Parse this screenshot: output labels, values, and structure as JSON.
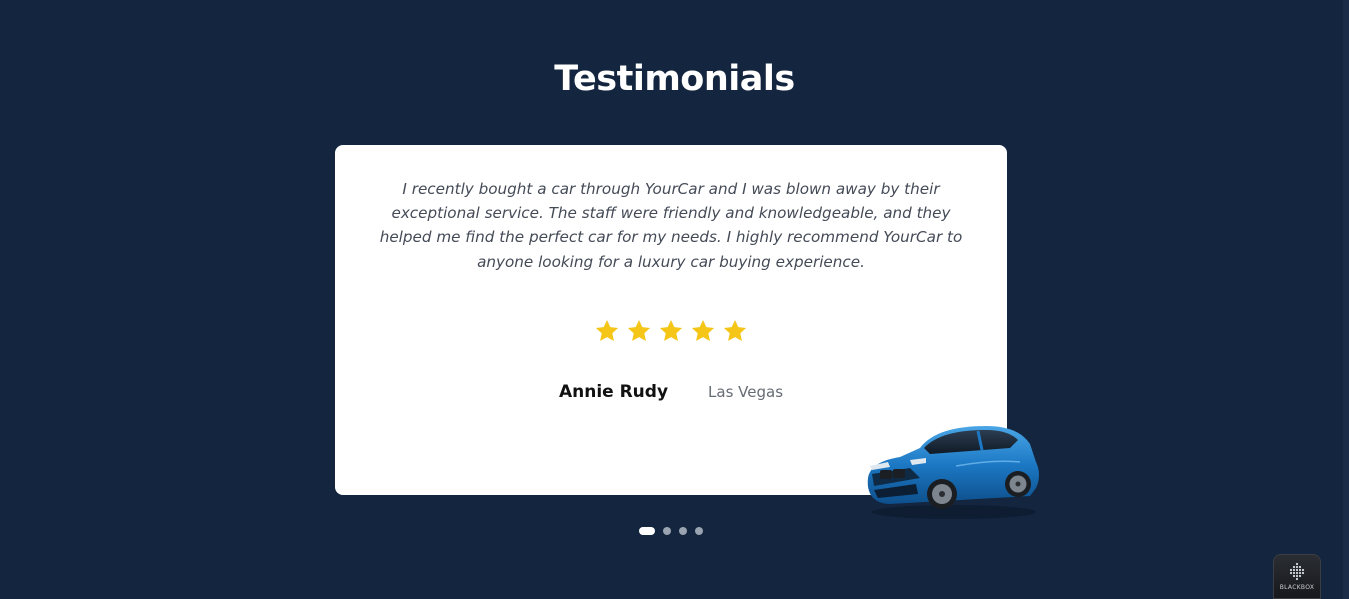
{
  "section": {
    "title": "Testimonials"
  },
  "testimonial": {
    "quote": "I recently bought a car through YourCar and I was blown away by their exceptional service. The staff were friendly and knowledgeable, and they helped me find the perfect car for my needs. I highly recommend YourCar to anyone looking for a luxury car buying experience.",
    "rating": 5,
    "rating_max": 5,
    "author": "Annie Rudy",
    "location": "Las Vegas",
    "image_icon": "car-image"
  },
  "carousel": {
    "slide_count": 4,
    "active_index": 0
  },
  "badge": {
    "label": "BLACKBOX",
    "icon": "blackbox-logo-icon"
  },
  "colors": {
    "background": "#13253f",
    "card": "#ffffff",
    "star": "#f5c518",
    "dot_active": "#ffffff",
    "dot_inactive": "#9aa3b0"
  }
}
